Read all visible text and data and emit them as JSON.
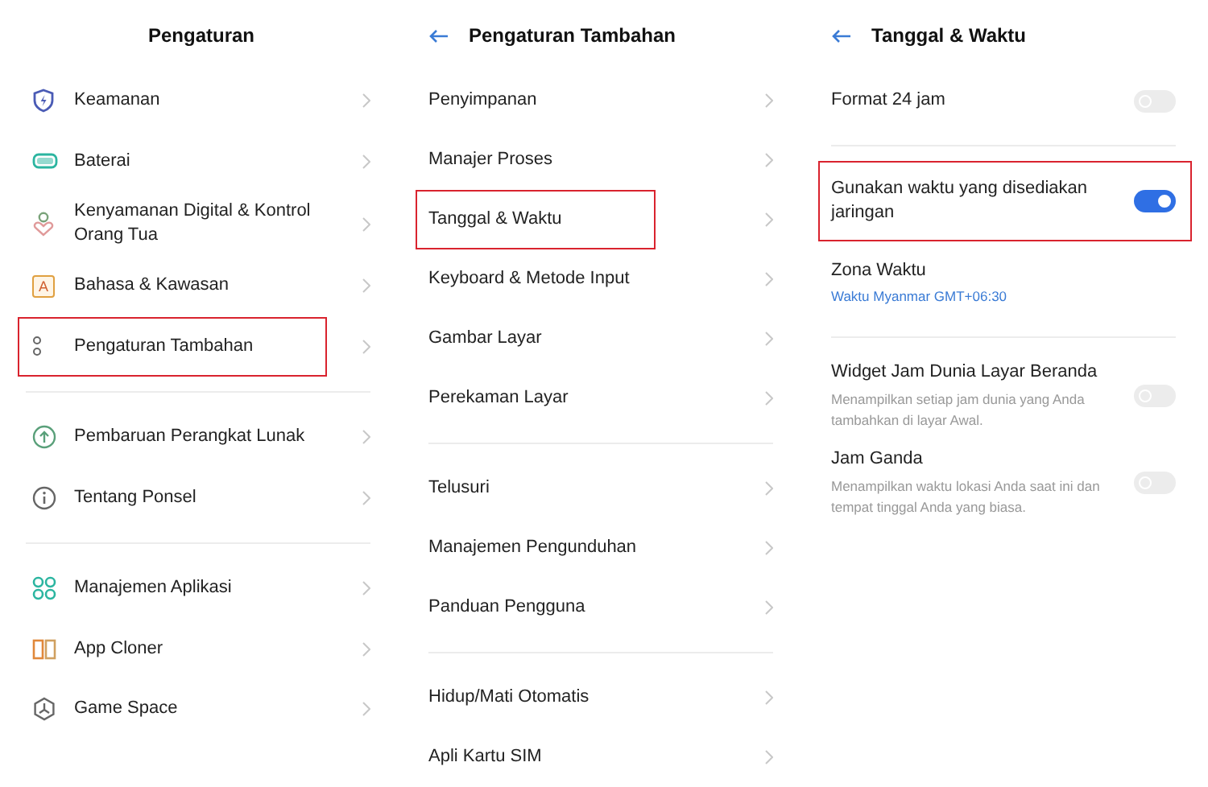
{
  "panels": [
    {
      "title": "Pengaturan",
      "back": false,
      "groups": [
        [
          {
            "kind": "link",
            "label": "Keamanan",
            "highlighted": false
          },
          {
            "kind": "link",
            "label": "Baterai",
            "highlighted": false
          },
          {
            "kind": "link",
            "label": "Kenyamanan Digital & Kontrol Orang Tua",
            "highlighted": false
          },
          {
            "kind": "link",
            "label": "Bahasa & Kawasan",
            "glyph": "A",
            "highlighted": false
          },
          {
            "kind": "link",
            "label": "Pengaturan Tambahan",
            "highlighted": true
          }
        ],
        [
          {
            "kind": "link",
            "label": "Pembaruan Perangkat Lunak",
            "highlighted": false
          },
          {
            "kind": "link",
            "label": "Tentang Ponsel",
            "highlighted": false
          }
        ],
        [
          {
            "kind": "link",
            "label": "Manajemen Aplikasi",
            "highlighted": false
          },
          {
            "kind": "link",
            "label": "App Cloner",
            "highlighted": false
          },
          {
            "kind": "link",
            "label": "Game Space",
            "highlighted": false
          }
        ]
      ]
    },
    {
      "title": "Pengaturan Tambahan",
      "back": true,
      "groups": [
        [
          {
            "kind": "link",
            "label": "Penyimpanan",
            "highlighted": false
          },
          {
            "kind": "link",
            "label": "Manajer Proses",
            "highlighted": false
          },
          {
            "kind": "link",
            "label": "Tanggal & Waktu",
            "highlighted": true
          },
          {
            "kind": "link",
            "label": "Keyboard & Metode Input",
            "highlighted": false
          },
          {
            "kind": "link",
            "label": "Gambar Layar",
            "highlighted": false
          },
          {
            "kind": "link",
            "label": "Perekaman Layar",
            "highlighted": false
          }
        ],
        [
          {
            "kind": "link",
            "label": "Telusuri",
            "highlighted": false
          },
          {
            "kind": "link",
            "label": "Manajemen Pengunduhan",
            "highlighted": false
          },
          {
            "kind": "link",
            "label": "Panduan Pengguna",
            "highlighted": false
          }
        ],
        [
          {
            "kind": "link",
            "label": "Hidup/Mati Otomatis",
            "highlighted": false
          },
          {
            "kind": "link",
            "label": "Apli Kartu SIM",
            "highlighted": false
          }
        ]
      ]
    },
    {
      "title": "Tanggal & Waktu",
      "back": true,
      "groups": [
        [
          {
            "kind": "toggle",
            "label": "Format 24 jam",
            "on": false,
            "highlighted": false
          }
        ],
        [
          {
            "kind": "toggle",
            "label": "Gunakan waktu yang disediakan jaringan",
            "on": true,
            "highlighted": true
          },
          {
            "kind": "value",
            "label": "Zona Waktu",
            "value": "Waktu Myanmar GMT+06:30",
            "highlighted": false
          }
        ],
        [
          {
            "kind": "toggle",
            "label": "Widget Jam Dunia Layar Beranda",
            "description": "Menampilkan setiap jam dunia yang Anda tambahkan di layar Awal.",
            "on": false,
            "highlighted": false
          },
          {
            "kind": "toggle",
            "label": "Jam Ganda",
            "description": "Menampilkan waktu lokasi Anda saat ini dan tempat tinggal Anda yang biasa.",
            "on": false,
            "highlighted": false
          }
        ]
      ]
    }
  ]
}
